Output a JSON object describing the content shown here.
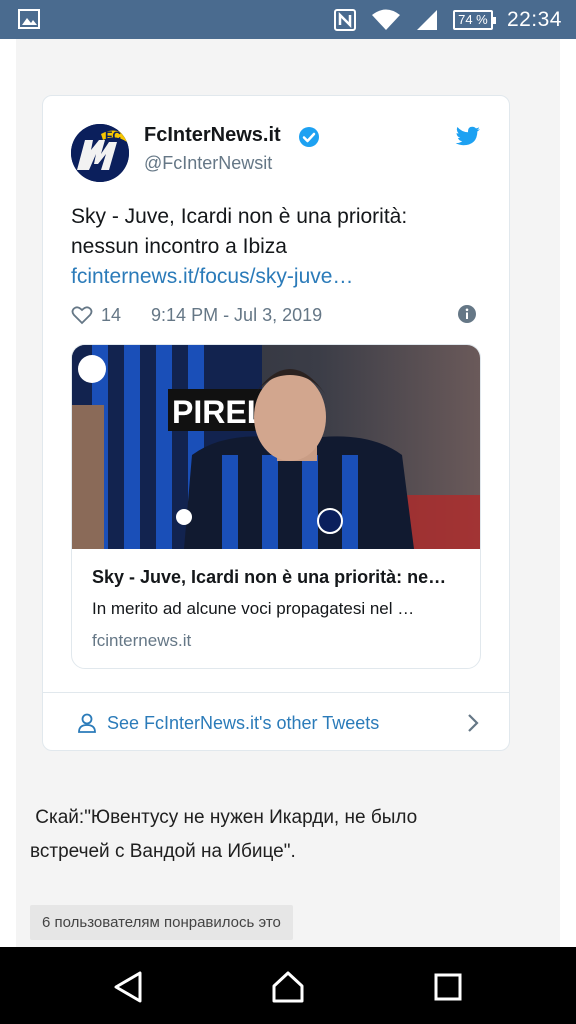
{
  "status_bar": {
    "battery": "74 %",
    "time": "22:34"
  },
  "tweet": {
    "author_name": "FcInterNews.it",
    "handle": "@FcInterNewsit",
    "text_line1": "Sky - Juve, Icardi non è una priorità:",
    "text_line2": "nessun incontro a Ibiza",
    "link": "fcinternews.it/focus/sky-juve…",
    "likes": "14",
    "timestamp": "9:14 PM - Jul 3, 2019",
    "card": {
      "title": "Sky - Juve, Icardi non è una priorità: ne…",
      "description": "In merito ad alcune voci propagatesi nel …",
      "domain": "fcinternews.it",
      "image_banner_text": "PIRELLI"
    },
    "more_tweets": "See FcInterNews.it's other Tweets"
  },
  "post": {
    "line1": " Скай:\"Ювентусу не нужен Икарди, не было",
    "line2": "встречей с Вандой на Ибице\".",
    "likes_badge": "6 пользователям понравилось это"
  },
  "colors": {
    "status_bar": "#4a6b8f",
    "twitter_blue": "#1da1f2",
    "link_blue": "#2b7bb9",
    "nav_bar": "#000000"
  }
}
